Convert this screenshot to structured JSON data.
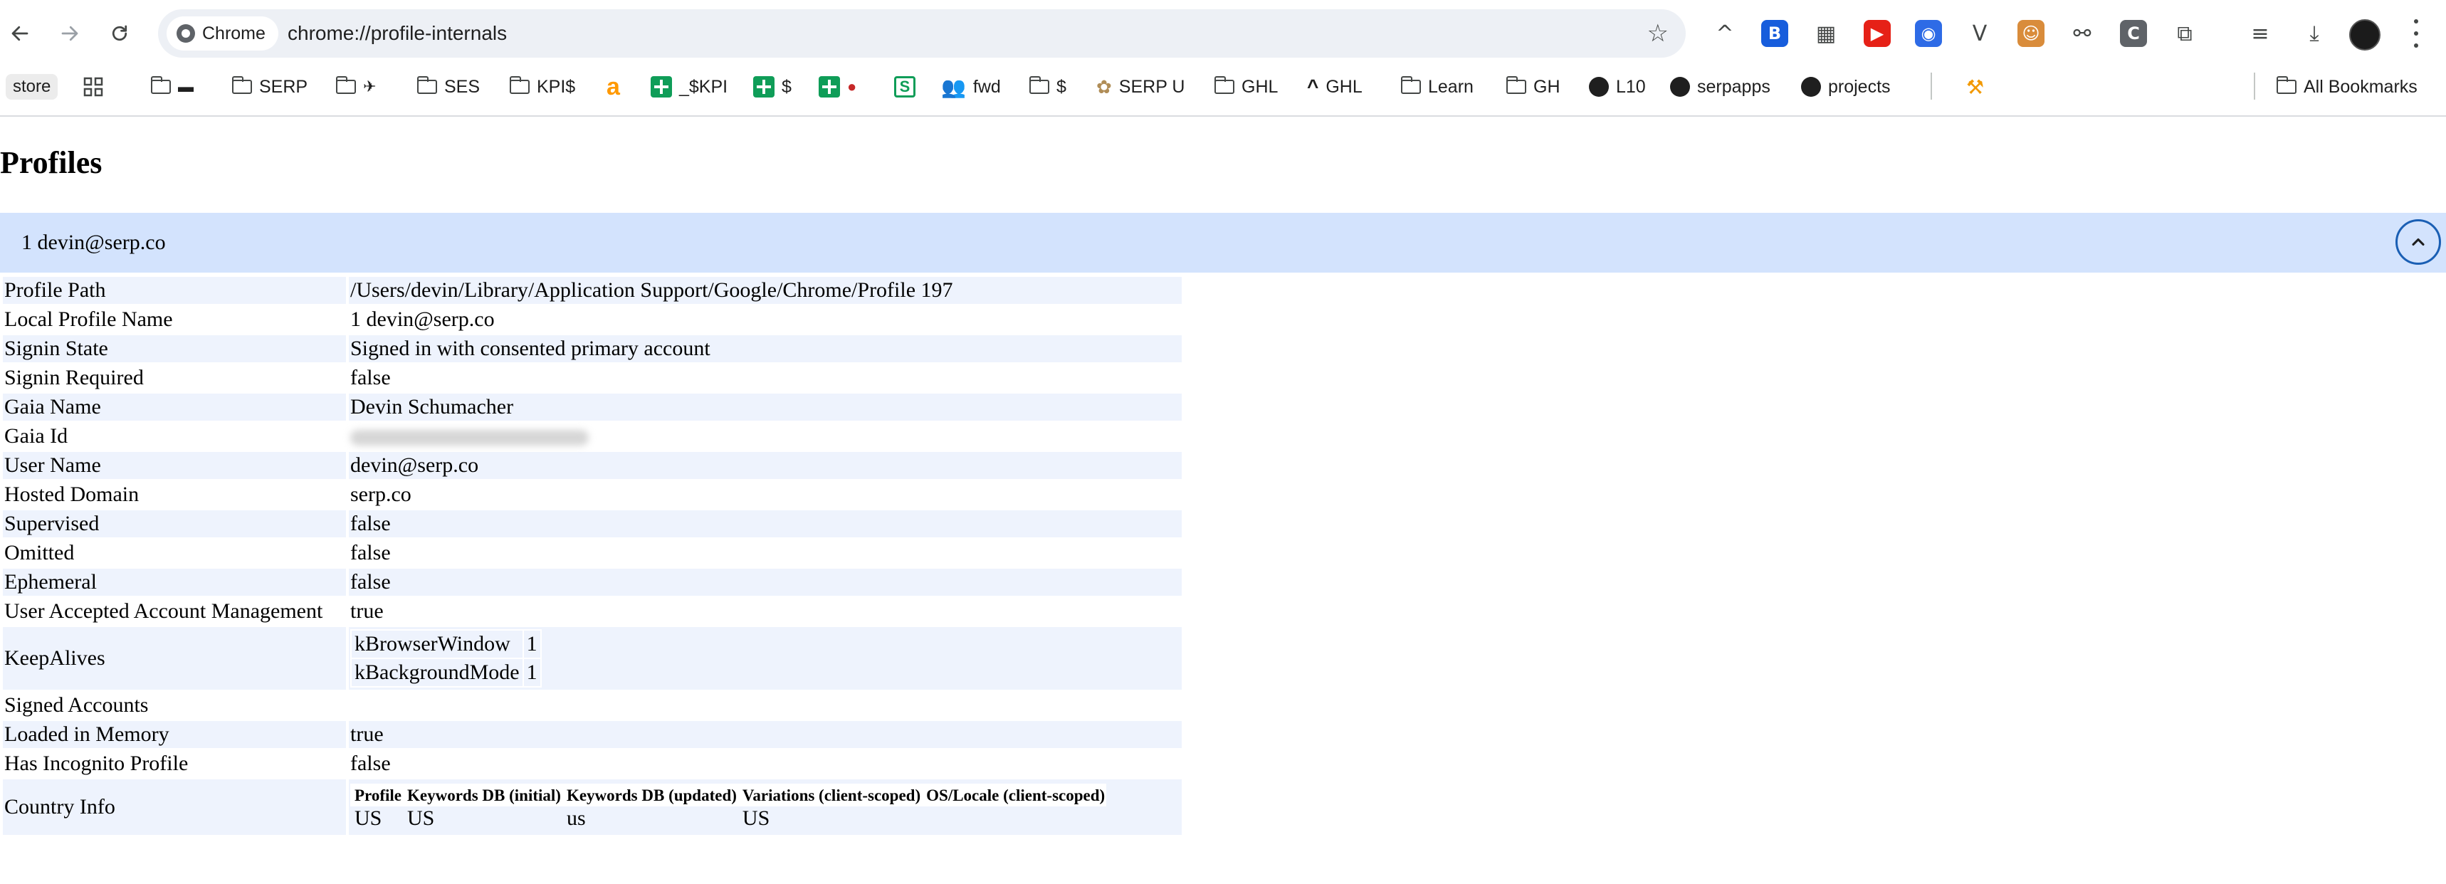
{
  "browser": {
    "chip_label": "Chrome",
    "url": "chrome://profile-internals",
    "extensions": [
      {
        "icon": "caret-up-icon",
        "glyph": "^",
        "color": ""
      },
      {
        "icon": "bitwarden-icon",
        "glyph": "B",
        "color": "#175ddc"
      },
      {
        "icon": "qr-code-icon",
        "glyph": "▦",
        "color": ""
      },
      {
        "icon": "youtube-icon",
        "glyph": "▶",
        "color": "#e62117"
      },
      {
        "icon": "blue-circle-extension-icon",
        "glyph": "◉",
        "color": "#2e6be6"
      },
      {
        "icon": "v-extension-icon",
        "glyph": "V",
        "color": ""
      },
      {
        "icon": "cartoon-face-extension-icon",
        "glyph": "☺",
        "color": "#d98c3b"
      },
      {
        "icon": "link-extension-icon",
        "glyph": "⚯",
        "color": ""
      },
      {
        "icon": "c-extension-icon",
        "glyph": "C",
        "color": "#5f6368"
      },
      {
        "icon": "puzzle-extensions-icon",
        "glyph": "⧉",
        "color": ""
      },
      {
        "icon": "reading-list-icon",
        "glyph": "≡",
        "color": ""
      },
      {
        "icon": "download-icon",
        "glyph": "⤓",
        "color": ""
      }
    ]
  },
  "bookmarks": {
    "store": "store",
    "items": [
      "SERP",
      "SES",
      "KPI$",
      "_$KPI",
      "$",
      "fwd",
      "$",
      "SERP U",
      "GHL",
      "GHL",
      "Learn",
      "GH",
      "L10",
      "serpapps",
      "projects"
    ],
    "all_bookmarks": "All Bookmarks"
  },
  "page": {
    "title": "Profiles",
    "profile_header": "1 devin@serp.co",
    "rows": [
      {
        "key": "Profile Path",
        "value": "/Users/devin/Library/Application Support/Google/Chrome/Profile 197"
      },
      {
        "key": "Local Profile Name",
        "value": "1 devin@serp.co"
      },
      {
        "key": "Signin State",
        "value": "Signed in with consented primary account"
      },
      {
        "key": "Signin Required",
        "value": "false"
      },
      {
        "key": "Gaia Name",
        "value": "Devin Schumacher"
      },
      {
        "key": "Gaia Id",
        "value": ""
      },
      {
        "key": "User Name",
        "value": "devin@serp.co"
      },
      {
        "key": "Hosted Domain",
        "value": "serp.co"
      },
      {
        "key": "Supervised",
        "value": "false"
      },
      {
        "key": "Omitted",
        "value": "false"
      },
      {
        "key": "Ephemeral",
        "value": "false"
      },
      {
        "key": "User Accepted Account Management",
        "value": "true"
      },
      {
        "key": "KeepAlives",
        "value": ""
      },
      {
        "key": "Signed Accounts",
        "value": ""
      },
      {
        "key": "Loaded in Memory",
        "value": "true"
      },
      {
        "key": "Has Incognito Profile",
        "value": "false"
      },
      {
        "key": "Country Info",
        "value": ""
      }
    ],
    "keepalives": [
      {
        "name": "kBrowserWindow",
        "count": "1"
      },
      {
        "name": "kBackgroundMode",
        "count": "1"
      }
    ],
    "country_info": {
      "headers": [
        "Profile",
        "Keywords DB (initial)",
        "Keywords DB (updated)",
        "Variations (client-scoped)",
        "OS/Locale (client-scoped)"
      ],
      "values": [
        "US",
        "US",
        "us",
        "US",
        ""
      ]
    }
  }
}
